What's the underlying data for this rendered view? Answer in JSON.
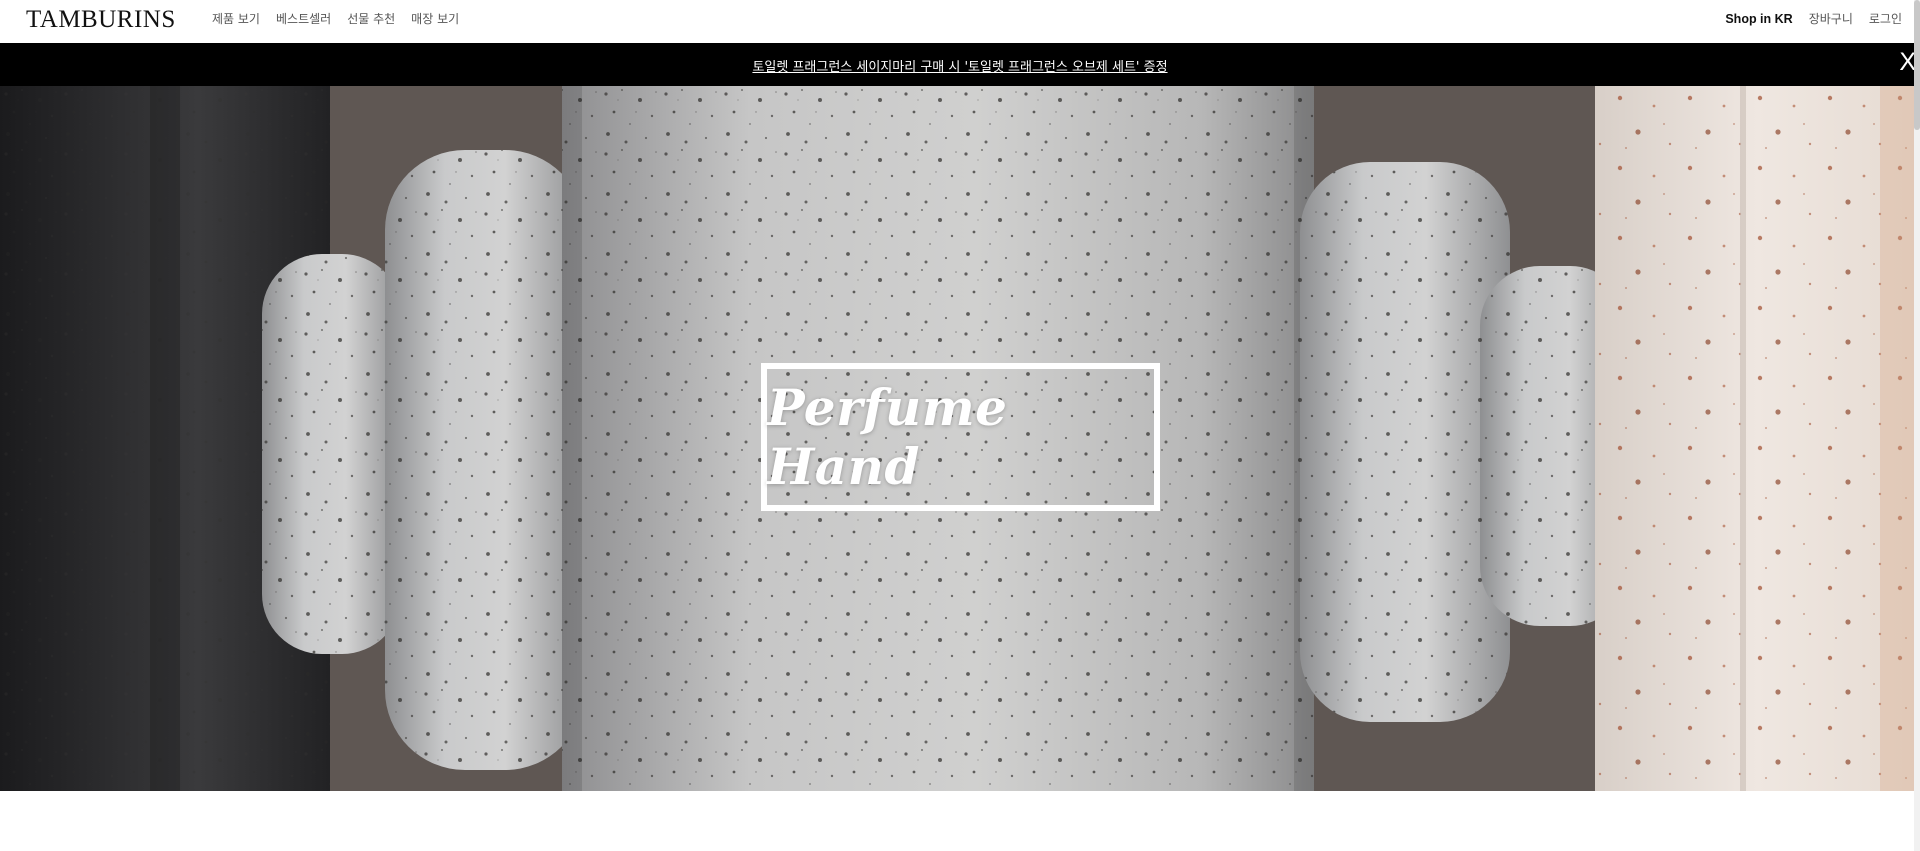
{
  "header": {
    "logo": "TAMBURINS",
    "nav": [
      "제품 보기",
      "베스트셀러",
      "선물 추천",
      "매장 보기"
    ],
    "util": {
      "shop_region": "Shop in KR",
      "cart": "장바구니",
      "login": "로그인"
    }
  },
  "banner": {
    "text": "토일렛 프래그런스 세이지마리 구매 시 '토일렛 프래그런스 오브제 세트' 증정",
    "close_label": "X"
  },
  "hero": {
    "title": "Perfume Hand"
  },
  "icons": {
    "banner_close": "close-icon"
  }
}
